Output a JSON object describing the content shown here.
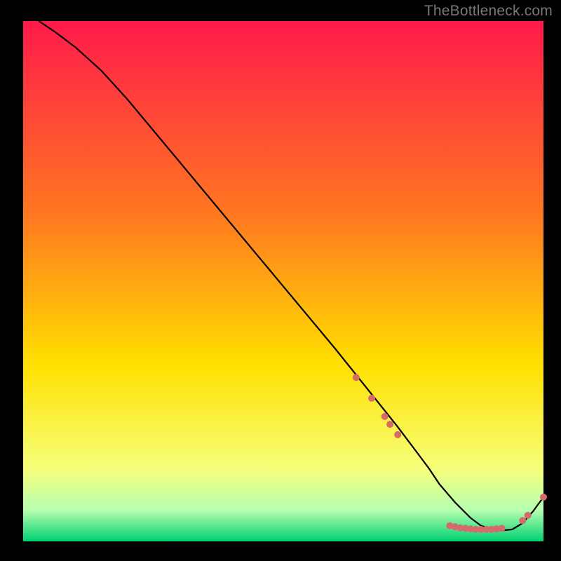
{
  "watermark": "TheBottleneck.com",
  "chart_data": {
    "type": "line",
    "title": "",
    "xlabel": "",
    "ylabel": "",
    "xlim": [
      0,
      100
    ],
    "ylim": [
      0,
      100
    ],
    "background_gradient": {
      "top": "#ff1a4b",
      "mid1": "#ff7a1f",
      "mid2": "#ffe000",
      "bottom": "#00d070"
    },
    "series": [
      {
        "name": "curve",
        "x": [
          3,
          6,
          10,
          15,
          20,
          25,
          30,
          35,
          40,
          45,
          50,
          55,
          60,
          64,
          68,
          72,
          75,
          78,
          80,
          83,
          86,
          88,
          90,
          92,
          94,
          96,
          98,
          100
        ],
        "y": [
          100,
          98,
          95,
          90.5,
          85,
          79,
          73,
          67,
          61,
          55,
          49,
          43,
          37,
          32,
          27,
          22,
          18,
          14,
          11,
          7.5,
          4.5,
          3,
          2.3,
          2.1,
          2.3,
          3.5,
          5.8,
          8.5
        ]
      }
    ],
    "markers": [
      {
        "x": 64.0,
        "y": 31.5
      },
      {
        "x": 67.0,
        "y": 27.5
      },
      {
        "x": 69.5,
        "y": 24.0
      },
      {
        "x": 70.5,
        "y": 22.5
      },
      {
        "x": 72.0,
        "y": 20.5
      },
      {
        "x": 82.0,
        "y": 3.0
      },
      {
        "x": 83.0,
        "y": 2.8
      },
      {
        "x": 84.0,
        "y": 2.6
      },
      {
        "x": 85.0,
        "y": 2.5
      },
      {
        "x": 86.0,
        "y": 2.4
      },
      {
        "x": 87.0,
        "y": 2.3
      },
      {
        "x": 88.0,
        "y": 2.3
      },
      {
        "x": 89.0,
        "y": 2.3
      },
      {
        "x": 90.0,
        "y": 2.3
      },
      {
        "x": 91.0,
        "y": 2.4
      },
      {
        "x": 92.0,
        "y": 2.5
      },
      {
        "x": 96.0,
        "y": 4.0
      },
      {
        "x": 97.0,
        "y": 5.0
      },
      {
        "x": 100.0,
        "y": 8.5
      }
    ],
    "marker_color": "#d46a6a",
    "marker_radius_px": 5,
    "line_color": "#000000"
  }
}
